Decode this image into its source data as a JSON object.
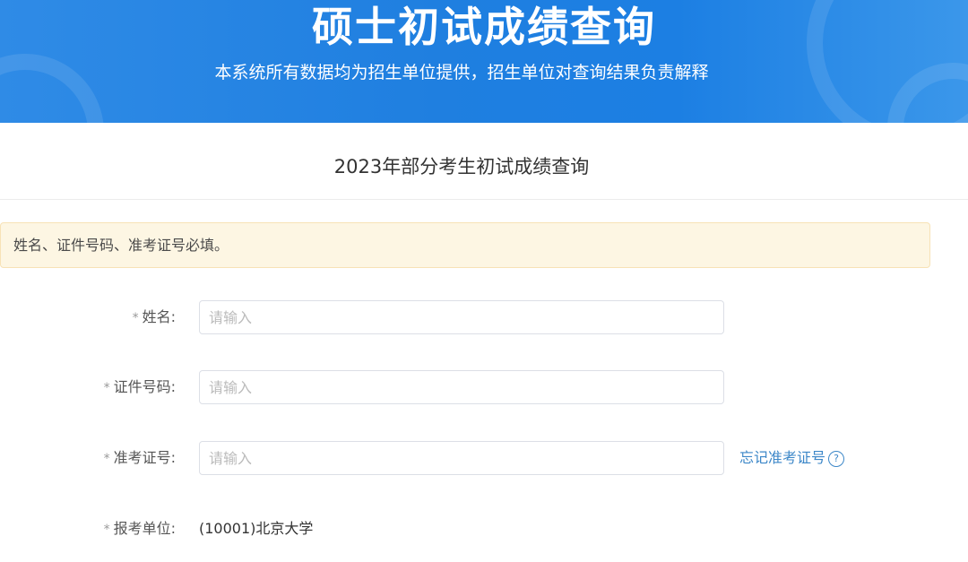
{
  "banner": {
    "title": "硕士初试成绩查询",
    "subtitle": "本系统所有数据均为招生单位提供，招生单位对查询结果负责解释"
  },
  "page": {
    "heading": "2023年部分考生初试成绩查询"
  },
  "notice": {
    "text": "姓名、证件号码、准考证号必填。"
  },
  "form": {
    "required_mark": "*",
    "name": {
      "label": "姓名:",
      "placeholder": "请输入",
      "value": ""
    },
    "id_number": {
      "label": "证件号码:",
      "placeholder": "请输入",
      "value": ""
    },
    "exam_number": {
      "label": "准考证号:",
      "placeholder": "请输入",
      "value": "",
      "forgot_link": "忘记准考证号",
      "help_icon": "?"
    },
    "institution": {
      "label": "报考单位:",
      "value": "(10001)北京大学"
    }
  },
  "colors": {
    "banner_blue": "#1f7fe0",
    "link_blue": "#3c87c8",
    "notice_bg": "#fdf6e3"
  },
  "icons": {
    "help": "question-circle-icon"
  }
}
